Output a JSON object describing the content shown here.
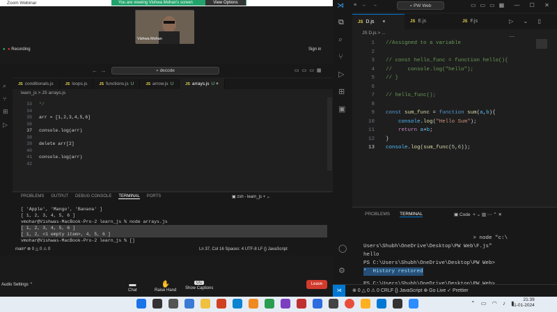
{
  "zoom": {
    "title": "Zoom Webinar",
    "banner": "You are viewing Vishwa Mohan's screen",
    "view_options": "View Options",
    "participant_name": "Vishwa Mohan",
    "recording": "Recording",
    "signin": "Sign in",
    "audio_settings": "Audio Settings",
    "chat": "Chat",
    "raise_hand": "Raise Hand",
    "show_captions": "Show Captions",
    "leave": "Leave"
  },
  "left_editor": {
    "search": "decode",
    "tabs": [
      {
        "label": "conditionals.js",
        "u": ""
      },
      {
        "label": "loops.js",
        "u": ""
      },
      {
        "label": "functions.js",
        "u": "U"
      },
      {
        "label": "arrow.js",
        "u": "U"
      },
      {
        "label": "arrays.js",
        "u": "U"
      }
    ],
    "breadcrumb": "learn_js  >  JS  arrays.js",
    "lines": [
      {
        "n": "33",
        "t": "*/"
      },
      {
        "n": "34",
        "t": ""
      },
      {
        "n": "35",
        "t": "arr = [1,2,3,4,5,6]"
      },
      {
        "n": "36",
        "t": ""
      },
      {
        "n": "37",
        "t": "console.log(arr)"
      },
      {
        "n": "38",
        "t": ""
      },
      {
        "n": "39",
        "t": "delete arr[2]"
      },
      {
        "n": "40",
        "t": ""
      },
      {
        "n": "41",
        "t": "console.log(arr)"
      },
      {
        "n": "42",
        "t": ""
      }
    ],
    "panel_tabs": [
      "PROBLEMS",
      "OUTPUT",
      "DEBUG CONSOLE",
      "TERMINAL",
      "PORTS"
    ],
    "terminal_name": "zsh - learn_js",
    "terminal": [
      "[ 'Apple', 'Mango', 'Banana' ]",
      "[ 1, 2, 3, 4, 5, 6 ]",
      "vmohar@Vishwas-MacBook-Pro-2 learn_js % node arrays.js",
      "[ 1, 2, 3, 4, 5, 6 ]",
      "[ 1, 2, <1 empty item>, 4, 5, 6 ]",
      "vmohar@Vishwas-MacBook-Pro-2 learn_js % []"
    ],
    "status_left": "main*   ⊗ 0 △ 0   ⚠ 0",
    "status_right": "Ln 37, Col 16   Spaces: 4   UTF-8   LF   {} JavaScript"
  },
  "right_editor": {
    "search": "PW Web",
    "tabs": [
      "D.js",
      "E.js",
      "F.js"
    ],
    "breadcrumb": "JS  D.js  >  ...",
    "lines": [
      {
        "n": "1",
        "t": "//Assigned to a variable"
      },
      {
        "n": "2",
        "t": ""
      },
      {
        "n": "3",
        "t": "// const hello_func = function hello(){"
      },
      {
        "n": "4",
        "t": "//     console.log(\"hello\");"
      },
      {
        "n": "5",
        "t": "// }"
      },
      {
        "n": "6",
        "t": ""
      },
      {
        "n": "7",
        "t": "// hello_func();"
      },
      {
        "n": "8",
        "t": ""
      },
      {
        "n": "9",
        "t": "const sum_func = function sum(a,b){"
      },
      {
        "n": "10",
        "t": "    console.log(\"Hello Sum\");"
      },
      {
        "n": "11",
        "t": "    return a+b;"
      },
      {
        "n": "12",
        "t": "}"
      },
      {
        "n": "13",
        "t": "console.log(sum_func(5,6));"
      }
    ],
    "panel_tabs": [
      "PROBLEMS",
      "TERMINAL"
    ],
    "terminal_shell": "Code",
    "terminal": [
      "                                   > node \"c:\\",
      "Users\\Shubh\\OneDrive\\Desktop\\PW Web\\F.js\"",
      "hello",
      "PS C:\\Users\\Shubh\\OneDrive\\Desktop\\PW Web>",
      "*  History restored",
      "",
      "PS C:\\Users\\Shubh\\OneDrive\\Desktop\\PW Web>"
    ],
    "status": "⊗ 0 △ 0   ⚠ 0       CRLF   {} JavaScript   ⊕ Go Live   ✓ Prettier"
  },
  "taskbar": {
    "time": "21:39",
    "date": "11-01-2024"
  }
}
